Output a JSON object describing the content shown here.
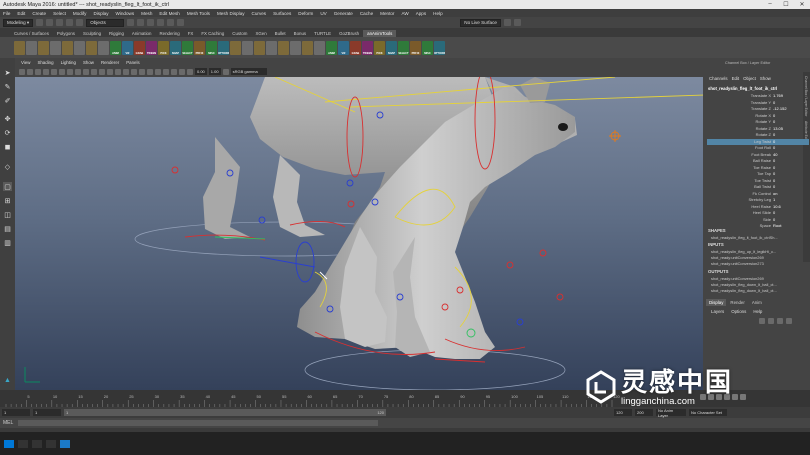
{
  "titlebar": {
    "text": "Autodesk Maya 2016: untitled*   ---   shot_readyslin_fleg_lt_foot_ik_ctrl"
  },
  "menubar": {
    "items": [
      "File",
      "Edit",
      "Create",
      "Select",
      "Modify",
      "Display",
      "Windows",
      "Mesh",
      "Edit Mesh",
      "Mesh Tools",
      "Mesh Display",
      "Curves",
      "Surfaces",
      "Deform",
      "UV",
      "Generate",
      "Cache",
      "Mentor",
      "AW",
      "Apps",
      "Help"
    ]
  },
  "statusline": {
    "mode": "Modeling",
    "objects": "Objects",
    "live": "No Live Surface"
  },
  "shelf": {
    "tabs": [
      "Curves / Surfaces",
      "Polygons",
      "Sculpting",
      "Rigging",
      "Animation",
      "Rendering",
      "FX",
      "FX Caching",
      "Custom",
      "XGen",
      "Bullet",
      "Bonus",
      "TURTLE",
      "GoZBrush",
      "anAnimTools"
    ],
    "active_tab": "anAnimTools",
    "items": [
      {
        "label": "",
        "color": "#7d6a3a"
      },
      {
        "label": "",
        "color": "#6c6c6c"
      },
      {
        "label": "",
        "color": "#7d6a3a"
      },
      {
        "label": "",
        "color": "#6c6c6c"
      },
      {
        "label": "",
        "color": "#7d6a3a"
      },
      {
        "label": "",
        "color": "#6c6c6c"
      },
      {
        "label": "",
        "color": "#7d6a3a"
      },
      {
        "label": "",
        "color": "#6c6c6c"
      },
      {
        "label": "ANIM",
        "color": "#2f7a3a"
      },
      {
        "label": "VIZ",
        "color": "#2f6a8a"
      },
      {
        "label": "GRAB",
        "color": "#8a3a2a"
      },
      {
        "label": "TWEEN",
        "color": "#7a2a6a"
      },
      {
        "label": "PICK",
        "color": "#7a6a2a"
      },
      {
        "label": "SNAP",
        "color": "#2a6a7a"
      },
      {
        "label": "SELECT",
        "color": "#2f7a3a"
      },
      {
        "label": "PRFIX",
        "color": "#7a5a2a"
      },
      {
        "label": "MISC",
        "color": "#2f7a3a"
      },
      {
        "label": "OPTIONS",
        "color": "#2a6a7a"
      },
      {
        "label": "",
        "color": "#7d6a3a"
      },
      {
        "label": "",
        "color": "#6c6c6c"
      },
      {
        "label": "",
        "color": "#7d6a3a"
      },
      {
        "label": "",
        "color": "#6c6c6c"
      },
      {
        "label": "",
        "color": "#7d6a3a"
      },
      {
        "label": "",
        "color": "#6c6c6c"
      },
      {
        "label": "",
        "color": "#7d6a3a"
      },
      {
        "label": "",
        "color": "#6c6c6c"
      },
      {
        "label": "ANIM",
        "color": "#2f7a3a"
      },
      {
        "label": "VIZ",
        "color": "#2f6a8a"
      },
      {
        "label": "GRAB",
        "color": "#8a3a2a"
      },
      {
        "label": "TWEEN",
        "color": "#7a2a6a"
      },
      {
        "label": "PICK",
        "color": "#7a6a2a"
      },
      {
        "label": "SNAP",
        "color": "#2a6a7a"
      },
      {
        "label": "SELECT",
        "color": "#2f7a3a"
      },
      {
        "label": "PRFIX",
        "color": "#7a5a2a"
      },
      {
        "label": "MISC",
        "color": "#2f7a3a"
      },
      {
        "label": "OPTIONS",
        "color": "#2a6a7a"
      }
    ]
  },
  "panel": {
    "menu": [
      "View",
      "Shading",
      "Lighting",
      "Show",
      "Renderer",
      "Panels"
    ],
    "near": "0.00",
    "far": "1.00",
    "colorspace": "sRGB gamma"
  },
  "channelbox": {
    "header": "Channel Box / Layer Editor",
    "tabs": [
      "Channels",
      "Edit",
      "Object",
      "Show"
    ],
    "object": "shot_readyslin_fleg_lt_foot_ik_ctrl",
    "attributes": [
      {
        "name": "Translate X",
        "value": "1.769"
      },
      {
        "name": "Translate Y",
        "value": "0"
      },
      {
        "name": "Translate Z",
        "value": "-12.152"
      },
      {
        "name": "Rotate X",
        "value": "0"
      },
      {
        "name": "Rotate Y",
        "value": "0"
      },
      {
        "name": "Rotate Z",
        "value": "13.05"
      },
      {
        "name": "Rotate Z",
        "value": "0"
      },
      {
        "name": "Leg Twist",
        "value": "0"
      },
      {
        "name": "Foot Roll",
        "value": "0"
      },
      {
        "name": "Foot Break",
        "value": "40"
      },
      {
        "name": "Ball Raise",
        "value": "0"
      },
      {
        "name": "Toe Raise",
        "value": "0"
      },
      {
        "name": "Toe Tap",
        "value": "0"
      },
      {
        "name": "Toe Twist",
        "value": "0"
      },
      {
        "name": "Ball Twist",
        "value": "0"
      },
      {
        "name": "Fk Control",
        "value": "on"
      },
      {
        "name": "Stretchy Leg",
        "value": "1"
      },
      {
        "name": "Heel Raise",
        "value": "10.6"
      },
      {
        "name": "Heel Slide",
        "value": "0"
      },
      {
        "name": "Side",
        "value": "0"
      },
      {
        "name": "Space",
        "value": "Root"
      }
    ],
    "highlight_index": 7,
    "shapes_label": "SHAPES",
    "shapes": [
      "shot_readyslin_fleg_lt_foot_ik_ctrlSh..."
    ],
    "inputs_label": "INPUTS",
    "inputs": [
      "shot_readyslin_fleg_up_lt_legikHi_c...",
      "shot_ready:unitConversion269",
      "shot_ready:unitConversion273"
    ],
    "outputs_label": "OUTPUTS",
    "outputs": [
      "shot_ready:unitConversion269",
      "shot_readyslin_fleg_down_lt_ball_ct...",
      "shot_readyslin_fleg_down_lt_ball_ct..."
    ],
    "layer_tabs": [
      "Display",
      "Render",
      "Anim"
    ],
    "layer_menu": [
      "Layers",
      "Options",
      "Help"
    ],
    "side_tabs": [
      "Channel Box / Layer Editor",
      "Attribute Editor"
    ]
  },
  "timeline": {
    "start": 1,
    "end": 120,
    "ticks": [
      5,
      10,
      15,
      20,
      25,
      30,
      35,
      40,
      45,
      50,
      55,
      60,
      65,
      70,
      75,
      80,
      85,
      90,
      95,
      100,
      105,
      110,
      115,
      120
    ]
  },
  "range": {
    "start": "1",
    "inner_start": "1",
    "inner_end": "120",
    "end": "120",
    "max": "200",
    "anim_layer": "No Anim Layer",
    "char_set": "No Character Set"
  },
  "cmdline": {
    "label": "MEL"
  },
  "watermark": {
    "cn": "灵感中国",
    "en": "lingganchina.com"
  },
  "colors": {
    "highlight": "#5285a6",
    "ctrl_red": "#d83030",
    "ctrl_yellow": "#e5d23a",
    "ctrl_blue": "#2a3fd0",
    "ctrl_green": "#30c060"
  }
}
